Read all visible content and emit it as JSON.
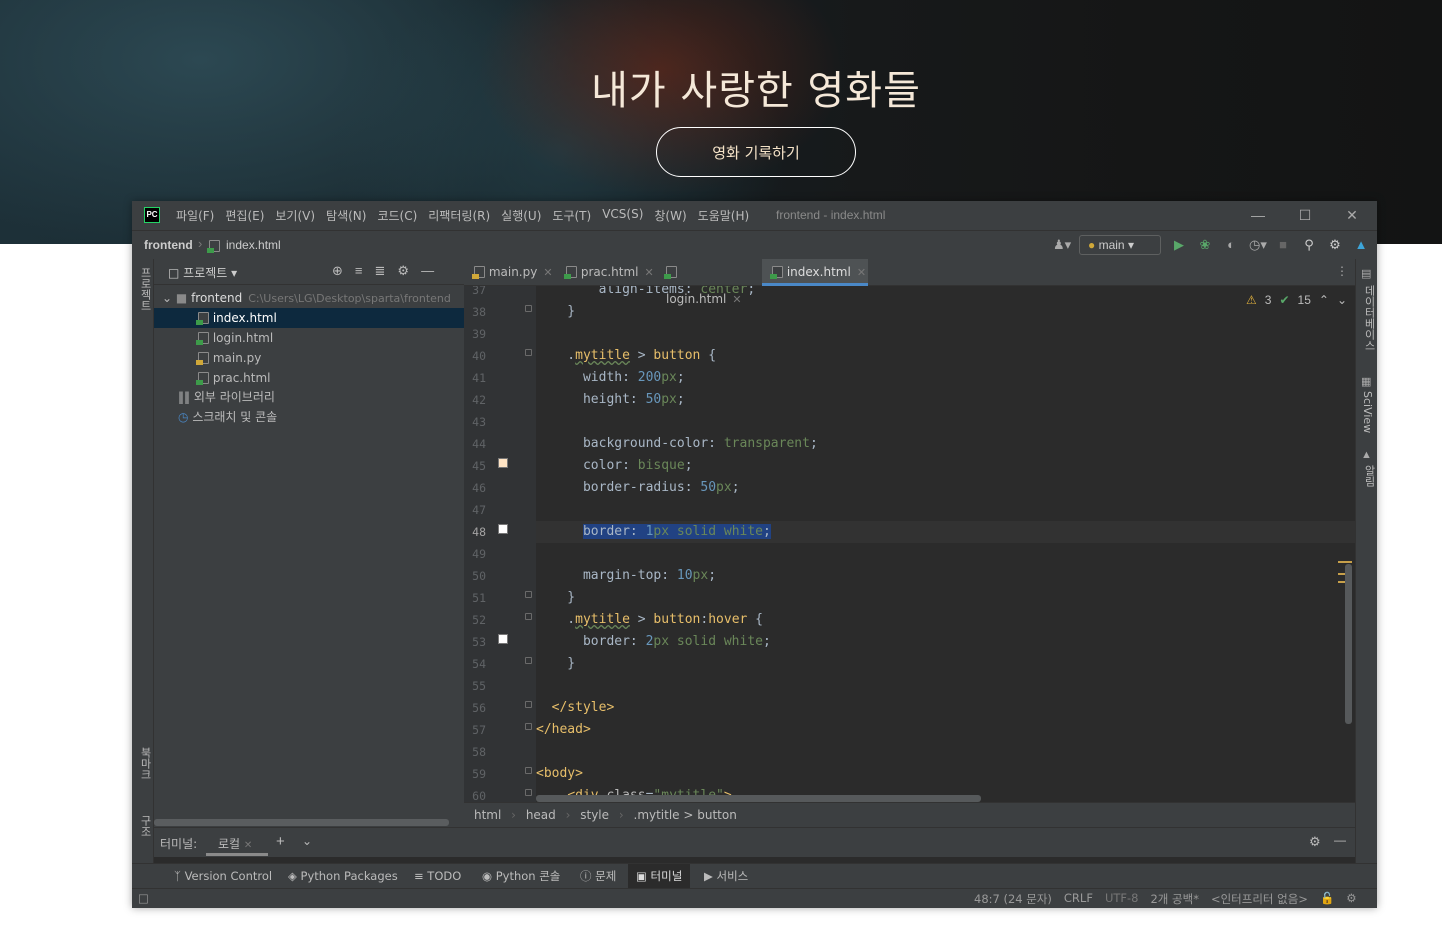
{
  "hero": {
    "title": "내가 사랑한 영화들",
    "button_label": "영화 기록하기"
  },
  "ide": {
    "logo": "PC",
    "menu": [
      "파일(F)",
      "편집(E)",
      "보기(V)",
      "탐색(N)",
      "코드(C)",
      "리팩터링(R)",
      "실행(U)",
      "도구(T)",
      "VCS(S)",
      "창(W)",
      "도움말(H)"
    ],
    "window_title": "frontend - index.html",
    "nav": {
      "project": "frontend",
      "file": "index.html",
      "run_config": "main"
    },
    "left_strip": {
      "project": "프로젝트",
      "bookmarks": "북마크",
      "structure": "구조"
    },
    "right_strip": {
      "database": "데이터베이스",
      "sciview": "SciView",
      "notifications": "알림"
    },
    "project_panel": {
      "title": "프로젝트",
      "root": "frontend",
      "root_path": "C:\\Users\\LG\\Desktop\\sparta\\frontend",
      "files": [
        "index.html",
        "login.html",
        "main.py",
        "prac.html"
      ],
      "external_libs": "외부 라이브러리",
      "scratches": "스크래치 및 콘솔"
    },
    "tabs": [
      {
        "label": "main.py"
      },
      {
        "label": "prac.html"
      },
      {
        "label": "login.html"
      },
      {
        "label": "index.html"
      }
    ],
    "inspections": {
      "warnings": "3",
      "ok": "15"
    },
    "line_numbers": [
      "37",
      "38",
      "39",
      "40",
      "41",
      "42",
      "43",
      "44",
      "45",
      "46",
      "47",
      "48",
      "49",
      "50",
      "51",
      "52",
      "53",
      "54",
      "55",
      "56",
      "57",
      "58",
      "59",
      "60"
    ],
    "editor_breadcrumb": [
      "html",
      "head",
      "style",
      ".mytitle > button"
    ],
    "terminal": {
      "label": "터미널:",
      "tab": "로컬"
    },
    "toolwindows": [
      "Version Control",
      "Python Packages",
      "TODO",
      "Python 콘솔",
      "문제",
      "터미널",
      "서비스"
    ],
    "status": {
      "position": "48:7 (24 문자)",
      "line_sep": "CRLF",
      "encoding": "UTF-8",
      "indent": "2개 공백*",
      "interpreter": "<인터프리터 없음>"
    },
    "colors": {
      "swatch_bisque": "#ffe4c4",
      "swatch_white": "#ffffff",
      "accent": "#4a88c7"
    }
  }
}
